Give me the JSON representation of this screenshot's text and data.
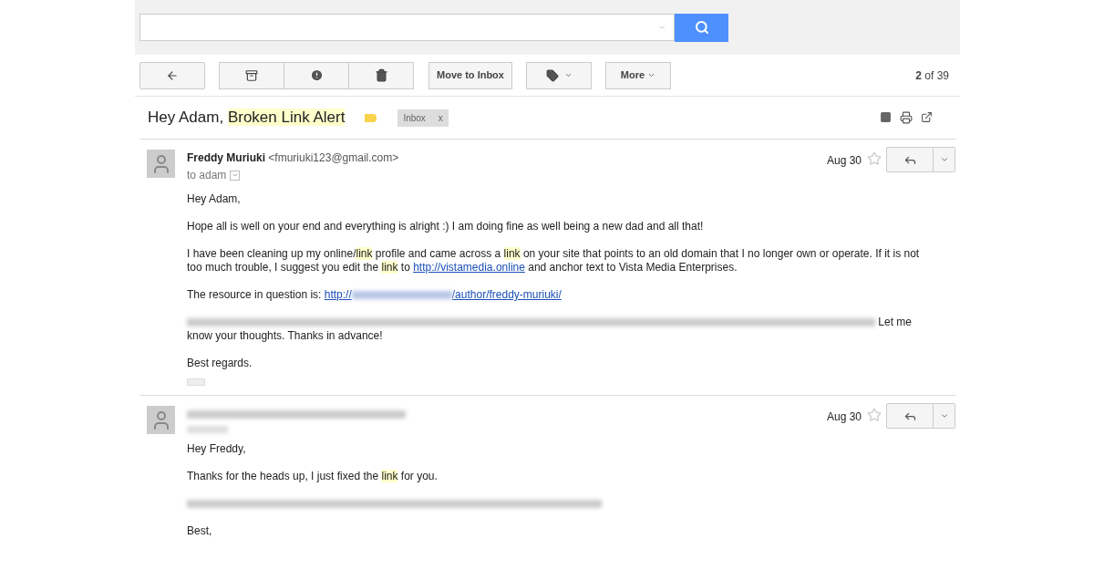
{
  "toolbar": {
    "move_button": "Move to Inbox",
    "more_button": "More",
    "pager": {
      "current": "2",
      "rest": " of 39"
    }
  },
  "subject": {
    "segments": [
      {
        "kind": "plain",
        "text": "Hey Adam, "
      },
      {
        "kind": "highlight",
        "text": "Broken Link Alert"
      }
    ],
    "label": {
      "name": "Inbox",
      "remove": "x"
    }
  },
  "messages": [
    {
      "sender": "Freddy Muriuki",
      "email": "<fmuriuki123@gmail.com>",
      "to": "to adam",
      "date": "Aug 30",
      "starred": false,
      "trimmed": true,
      "paragraphs": [
        [
          {
            "kind": "plain",
            "text": "Hey Adam,"
          }
        ],
        [
          {
            "kind": "plain",
            "text": "Hope all is well on your end and everything is alright :) I am doing fine as well being a new dad and all that!"
          }
        ],
        [
          {
            "kind": "plain",
            "text": "I have been cleaning up my online/"
          },
          {
            "kind": "highlight",
            "text": "link"
          },
          {
            "kind": "plain",
            "text": " profile and came across a "
          },
          {
            "kind": "highlight",
            "text": "link"
          },
          {
            "kind": "plain",
            "text": " on your site that points to an old domain that I no longer own or operate. If it is not too much trouble, I suggest you edit the "
          },
          {
            "kind": "highlight",
            "text": "link"
          },
          {
            "kind": "plain",
            "text": " to "
          },
          {
            "kind": "link",
            "text": "http://vistamedia.online"
          },
          {
            "kind": "plain",
            "text": " and anchor text to Vista Media Enterprises."
          }
        ],
        [
          {
            "kind": "plain",
            "text": "The resource in question is: "
          },
          {
            "kind": "redacted_link",
            "text": "http://",
            "after": "/author/freddy-muriuki/"
          }
        ],
        [
          {
            "kind": "redacted"
          },
          {
            "kind": "plain",
            "text": " Let me know your thoughts. Thanks in advance!"
          }
        ],
        [
          {
            "kind": "plain",
            "text": "Best regards."
          }
        ]
      ]
    },
    {
      "date": "Aug 30",
      "starred": false,
      "trimmed": false,
      "paragraphs": [
        [
          {
            "kind": "plain",
            "text": "Hey Freddy,"
          }
        ],
        [
          {
            "kind": "plain",
            "text": "Thanks for the heads up, I just fixed the "
          },
          {
            "kind": "highlight",
            "text": "link"
          },
          {
            "kind": "plain",
            "text": " for you."
          }
        ],
        [
          {
            "kind": "redacted_line"
          }
        ],
        [
          {
            "kind": "plain",
            "text": "Best,"
          }
        ]
      ]
    }
  ]
}
